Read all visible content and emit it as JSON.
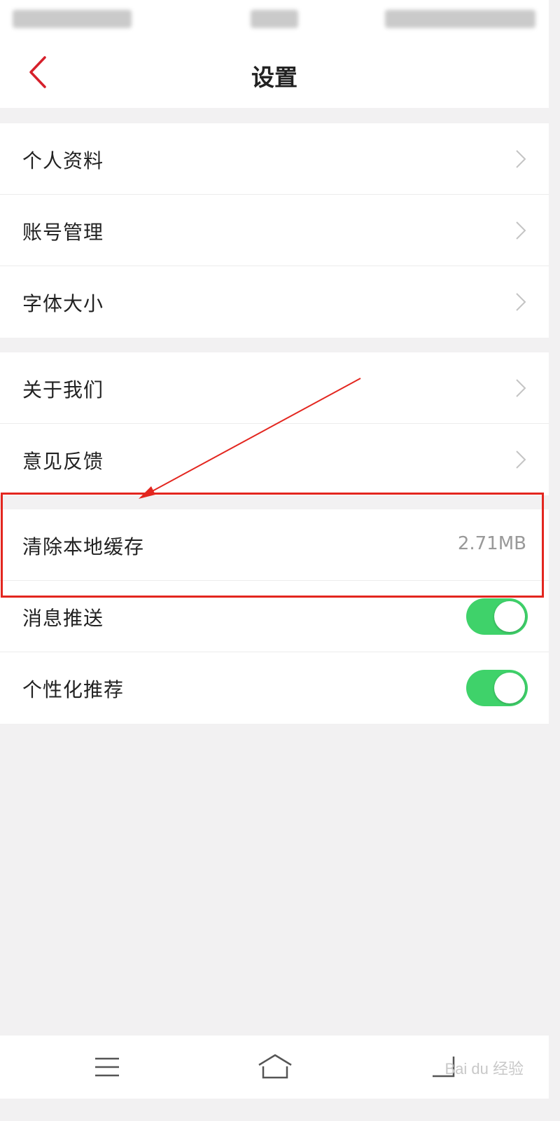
{
  "header": {
    "title": "设置"
  },
  "groups": [
    {
      "items": [
        {
          "label": "个人资料"
        },
        {
          "label": "账号管理"
        },
        {
          "label": "字体大小"
        }
      ]
    },
    {
      "items": [
        {
          "label": "关于我们"
        },
        {
          "label": "意见反馈"
        }
      ]
    },
    {
      "items": [
        {
          "label": "清除本地缓存",
          "value": "2.71MB"
        },
        {
          "label": "消息推送",
          "toggle": true
        },
        {
          "label": "个性化推荐",
          "toggle": true
        }
      ]
    }
  ],
  "colors": {
    "accent": "#d6202b",
    "toggle_on": "#3fd26a",
    "annotation": "#e3261f",
    "background": "#f2f1f2"
  },
  "icons": [
    "back-chevron-icon",
    "chevron-right-icon",
    "menu-icon",
    "home-icon",
    "recent-apps-icon"
  ],
  "watermark": "Bai du 经验"
}
